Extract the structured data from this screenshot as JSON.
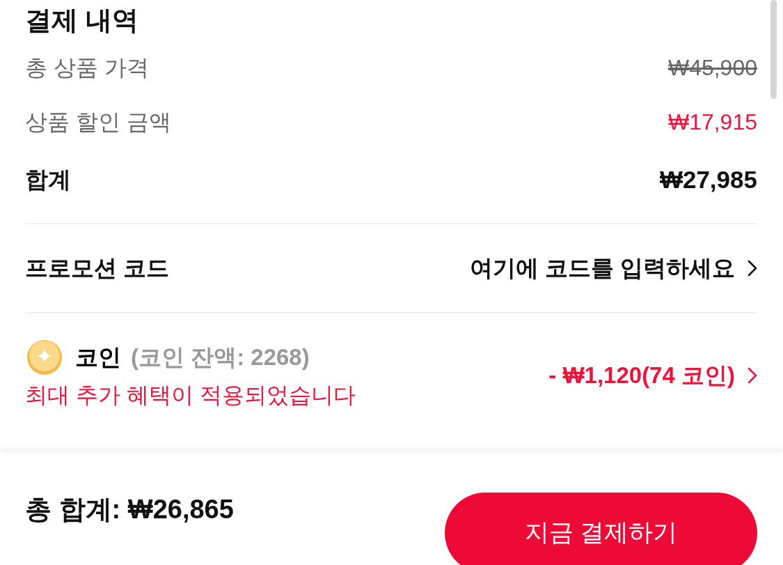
{
  "section_title": "결제 내역",
  "price_rows": [
    {
      "kind": "original",
      "label": "총 상품 가격",
      "value": "₩45,900"
    },
    {
      "kind": "discount",
      "label": "상품 할인 금액",
      "value": "₩17,915"
    },
    {
      "kind": "total",
      "label": "합계",
      "value": "₩27,985"
    }
  ],
  "promo": {
    "label": "프로모션 코드",
    "placeholder": "여기에 코드를 입력하세요"
  },
  "coins": {
    "label": "코인",
    "balance": "(코인 잔액: 2268)",
    "notice": "최대 추가 혜택이 적용되었습니다",
    "amount": "- ₩1,120(74 코인)"
  },
  "footer": {
    "total": "총 합계: ₩26,865",
    "button": "지금 결제하기"
  }
}
